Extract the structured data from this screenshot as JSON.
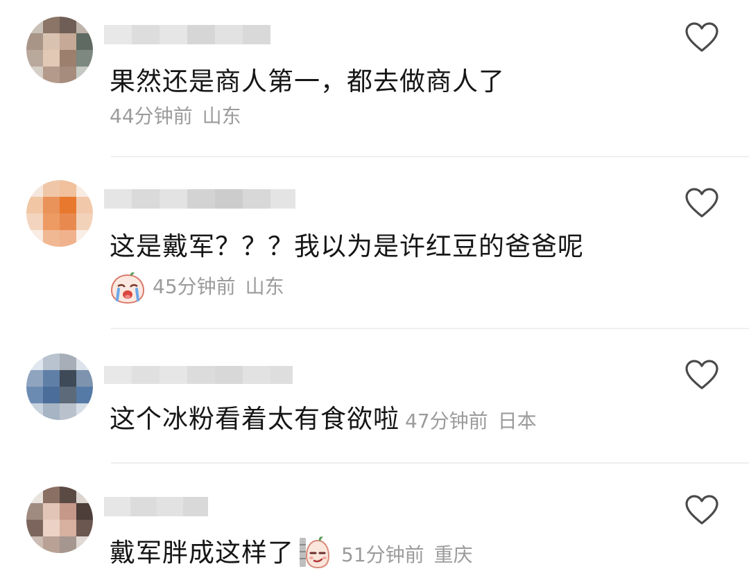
{
  "comments": [
    {
      "text": "果然还是商人第一，都去做商人了",
      "time": "44分钟前",
      "location": "山东",
      "sticker": null
    },
    {
      "text": "这是戴军？？？我以为是许红豆的爸爸呢",
      "time": "45分钟前",
      "location": "山东",
      "sticker": "crying-face-sticker"
    },
    {
      "text": "这个冰粉看着太有食欲啦",
      "time": "47分钟前",
      "location": "日本",
      "sticker": null
    },
    {
      "text": "戴军胖成这样了",
      "time": "51分钟前",
      "location": "重庆",
      "sticker": "smirk-face-sticker"
    }
  ],
  "icons": {
    "like": "heart-outline-icon"
  },
  "colors": {
    "text": "#161616",
    "meta": "#9b9b9b",
    "divider": "#efefef",
    "heart": "#4a4a4a"
  }
}
